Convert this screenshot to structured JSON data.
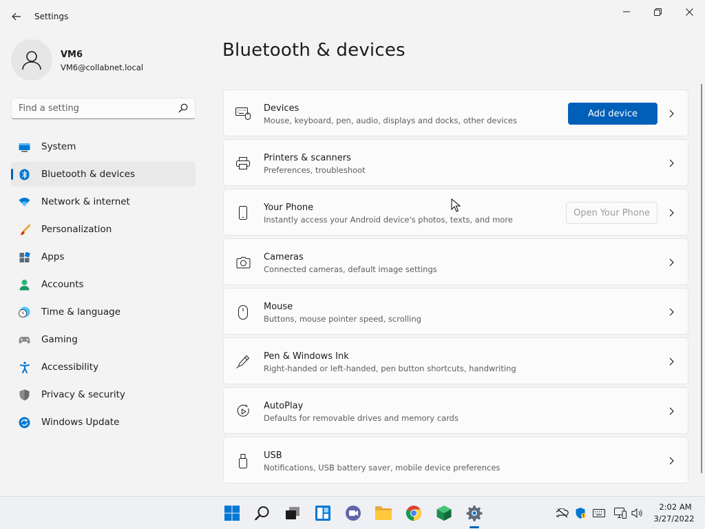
{
  "window": {
    "title": "Settings"
  },
  "profile": {
    "name": "VM6",
    "email": "VM6@collabnet.local"
  },
  "search": {
    "placeholder": "Find a setting"
  },
  "nav": {
    "items": [
      {
        "label": "System",
        "icon": "system-icon"
      },
      {
        "label": "Bluetooth & devices",
        "icon": "bluetooth-icon",
        "active": true
      },
      {
        "label": "Network & internet",
        "icon": "wifi-icon"
      },
      {
        "label": "Personalization",
        "icon": "brush-icon"
      },
      {
        "label": "Apps",
        "icon": "apps-icon"
      },
      {
        "label": "Accounts",
        "icon": "accounts-icon"
      },
      {
        "label": "Time & language",
        "icon": "time-icon"
      },
      {
        "label": "Gaming",
        "icon": "gamepad-icon"
      },
      {
        "label": "Accessibility",
        "icon": "accessibility-icon"
      },
      {
        "label": "Privacy & security",
        "icon": "shield-icon"
      },
      {
        "label": "Windows Update",
        "icon": "update-icon"
      }
    ]
  },
  "main": {
    "title": "Bluetooth & devices",
    "cards": [
      {
        "title": "Devices",
        "subtitle": "Mouse, keyboard, pen, audio, displays and docks, other devices",
        "button": "Add device"
      },
      {
        "title": "Printers & scanners",
        "subtitle": "Preferences, troubleshoot"
      },
      {
        "title": "Your Phone",
        "subtitle": "Instantly access your Android device's photos, texts, and more",
        "button": "Open Your Phone"
      },
      {
        "title": "Cameras",
        "subtitle": "Connected cameras, default image settings"
      },
      {
        "title": "Mouse",
        "subtitle": "Buttons, mouse pointer speed, scrolling"
      },
      {
        "title": "Pen & Windows Ink",
        "subtitle": "Right-handed or left-handed, pen button shortcuts, handwriting"
      },
      {
        "title": "AutoPlay",
        "subtitle": "Defaults for removable drives and memory cards"
      },
      {
        "title": "USB",
        "subtitle": "Notifications, USB battery saver, mobile device preferences"
      }
    ]
  },
  "taskbar": {
    "time": "2:02 AM",
    "date": "3/27/2022"
  },
  "colors": {
    "accent": "#005fb8",
    "background": "#f3f3f3",
    "card": "#fbfbfb"
  }
}
